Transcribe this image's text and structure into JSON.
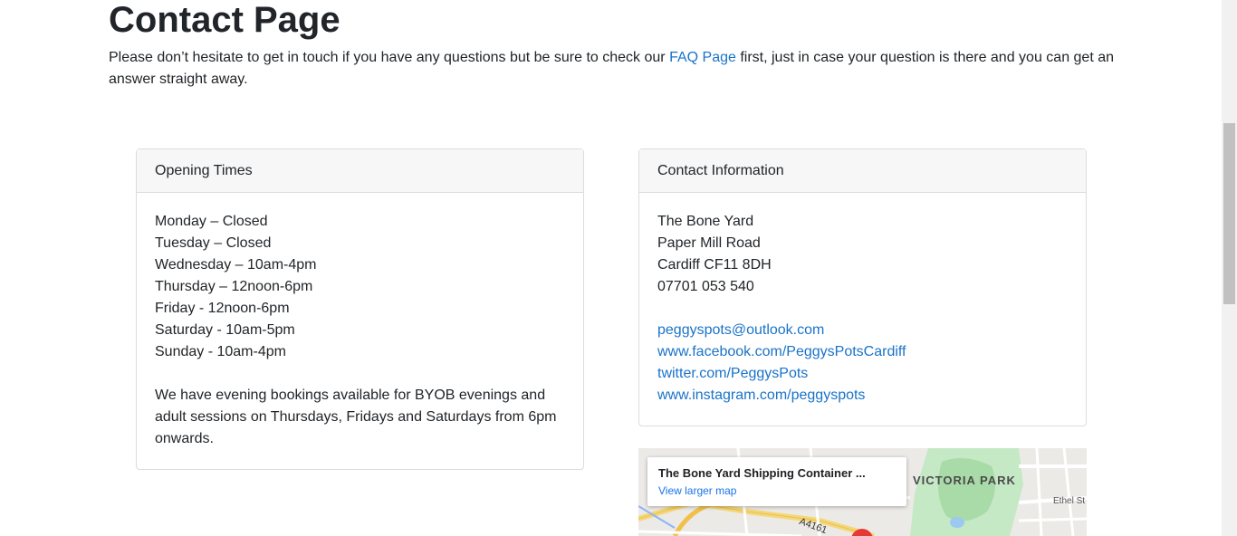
{
  "page": {
    "title": "Contact Page",
    "intro_before": "Please don’t hesitate to get in touch if you have any questions but be sure to check our ",
    "intro_link": "FAQ Page",
    "intro_after": " first, just in case your question is there and you can get an answer straight away."
  },
  "opening_times": {
    "header": "Opening Times",
    "days": [
      "Monday – Closed",
      "Tuesday – Closed",
      "Wednesday – 10am-4pm",
      "Thursday – 12noon-6pm",
      "Friday - 12noon-6pm",
      "Saturday - 10am-5pm",
      "Sunday - 10am-4pm"
    ],
    "note": "We have evening bookings available for BYOB evenings and adult sessions on Thursdays, Fridays and Saturdays from 6pm onwards."
  },
  "contact": {
    "header": "Contact Information",
    "address": [
      "The Bone Yard",
      "Paper Mill Road",
      "Cardiff CF11 8DH",
      "07701 053 540"
    ],
    "email": "peggyspots@outlook.com",
    "facebook": "www.facebook.com/PeggysPotsCardiff",
    "twitter": "twitter.com/PeggysPots",
    "instagram": "www.instagram.com/peggyspots"
  },
  "map": {
    "place_name": "The Bone Yard Shipping Container ...",
    "view_larger": "View larger map",
    "park_label": "VICTORIA PARK",
    "street_label": "Ethel St",
    "road_label": "A4161"
  }
}
